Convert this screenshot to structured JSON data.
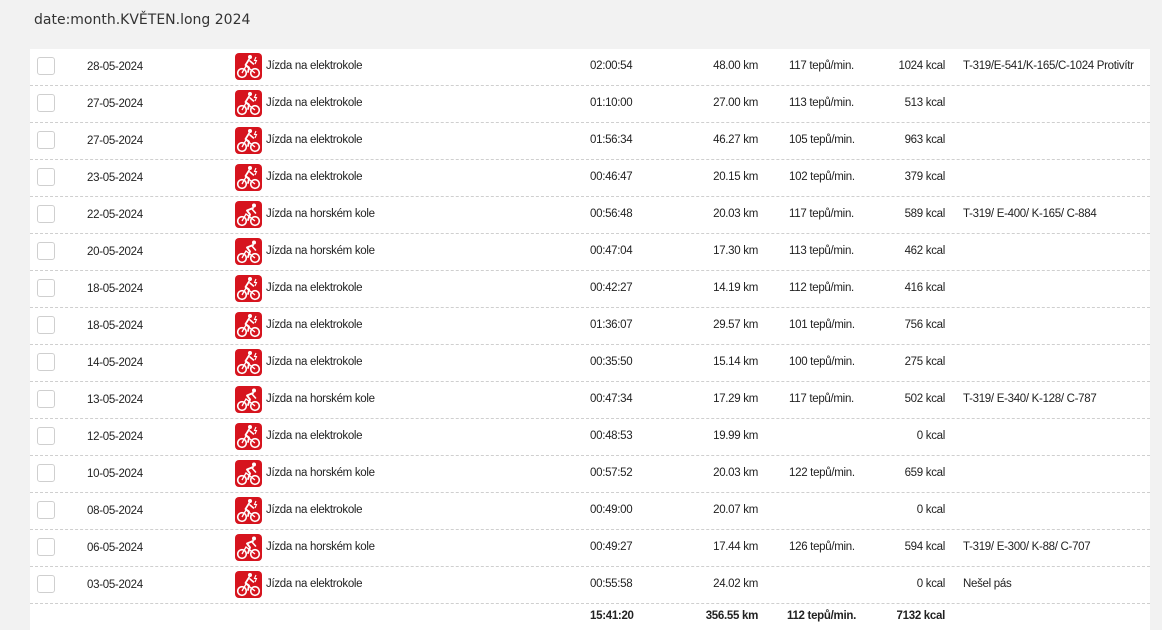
{
  "header": {
    "title": "date:month.KVĚTEN.long 2024"
  },
  "rows": [
    {
      "date": "28-05-2024",
      "type": "ebike",
      "activity": "Jízda na elektrokole",
      "duration": "02:00:54",
      "distance": "48.00 km",
      "heart_rate": "117 tepů/min.",
      "kcal": "1024 kcal",
      "note": "T-319/E-541/K-165/C-1024 Protivítr"
    },
    {
      "date": "27-05-2024",
      "type": "ebike",
      "activity": "Jízda na elektrokole",
      "duration": "01:10:00",
      "distance": "27.00 km",
      "heart_rate": "113 tepů/min.",
      "kcal": "513 kcal",
      "note": ""
    },
    {
      "date": "27-05-2024",
      "type": "ebike",
      "activity": "Jízda na elektrokole",
      "duration": "01:56:34",
      "distance": "46.27 km",
      "heart_rate": "105 tepů/min.",
      "kcal": "963 kcal",
      "note": ""
    },
    {
      "date": "23-05-2024",
      "type": "ebike",
      "activity": "Jízda na elektrokole",
      "duration": "00:46:47",
      "distance": "20.15 km",
      "heart_rate": "102 tepů/min.",
      "kcal": "379 kcal",
      "note": ""
    },
    {
      "date": "22-05-2024",
      "type": "mtb",
      "activity": "Jízda na horském kole",
      "duration": "00:56:48",
      "distance": "20.03 km",
      "heart_rate": "117 tepů/min.",
      "kcal": "589 kcal",
      "note": "T-319/ E-400/ K-165/ C-884"
    },
    {
      "date": "20-05-2024",
      "type": "mtb",
      "activity": "Jízda na horském kole",
      "duration": "00:47:04",
      "distance": "17.30 km",
      "heart_rate": "113 tepů/min.",
      "kcal": "462 kcal",
      "note": ""
    },
    {
      "date": "18-05-2024",
      "type": "ebike",
      "activity": "Jízda na elektrokole",
      "duration": "00:42:27",
      "distance": "14.19 km",
      "heart_rate": "112 tepů/min.",
      "kcal": "416 kcal",
      "note": ""
    },
    {
      "date": "18-05-2024",
      "type": "ebike",
      "activity": "Jízda na elektrokole",
      "duration": "01:36:07",
      "distance": "29.57 km",
      "heart_rate": "101 tepů/min.",
      "kcal": "756 kcal",
      "note": ""
    },
    {
      "date": "14-05-2024",
      "type": "ebike",
      "activity": "Jízda na elektrokole",
      "duration": "00:35:50",
      "distance": "15.14 km",
      "heart_rate": "100 tepů/min.",
      "kcal": "275 kcal",
      "note": ""
    },
    {
      "date": "13-05-2024",
      "type": "mtb",
      "activity": "Jízda na horském kole",
      "duration": "00:47:34",
      "distance": "17.29 km",
      "heart_rate": "117 tepů/min.",
      "kcal": "502 kcal",
      "note": "T-319/ E-340/ K-128/ C-787"
    },
    {
      "date": "12-05-2024",
      "type": "ebike",
      "activity": "Jízda na elektrokole",
      "duration": "00:48:53",
      "distance": "19.99 km",
      "heart_rate": "",
      "kcal": "0 kcal",
      "note": ""
    },
    {
      "date": "10-05-2024",
      "type": "mtb",
      "activity": "Jízda na horském kole",
      "duration": "00:57:52",
      "distance": "20.03 km",
      "heart_rate": "122 tepů/min.",
      "kcal": "659 kcal",
      "note": ""
    },
    {
      "date": "08-05-2024",
      "type": "ebike",
      "activity": "Jízda na elektrokole",
      "duration": "00:49:00",
      "distance": "20.07 km",
      "heart_rate": "",
      "kcal": "0 kcal",
      "note": ""
    },
    {
      "date": "06-05-2024",
      "type": "mtb",
      "activity": "Jízda na horském kole",
      "duration": "00:49:27",
      "distance": "17.44 km",
      "heart_rate": "126 tepů/min.",
      "kcal": "594 kcal",
      "note": "T-319/ E-300/ K-88/ C-707"
    },
    {
      "date": "03-05-2024",
      "type": "ebike",
      "activity": "Jízda na elektrokole",
      "duration": "00:55:58",
      "distance": "24.02 km",
      "heart_rate": "",
      "kcal": "0 kcal",
      "note": "Nešel pás"
    }
  ],
  "totals": {
    "duration": "15:41:20",
    "distance": "356.55 km",
    "heart_rate": "112 tepů/min.",
    "kcal": "7132 kcal"
  },
  "colors": {
    "icon_bg": "#d6141e",
    "page_bg": "#f2f2f2"
  },
  "icons": {
    "ebike": "electric-bike-icon",
    "mtb": "mountain-bike-icon"
  }
}
